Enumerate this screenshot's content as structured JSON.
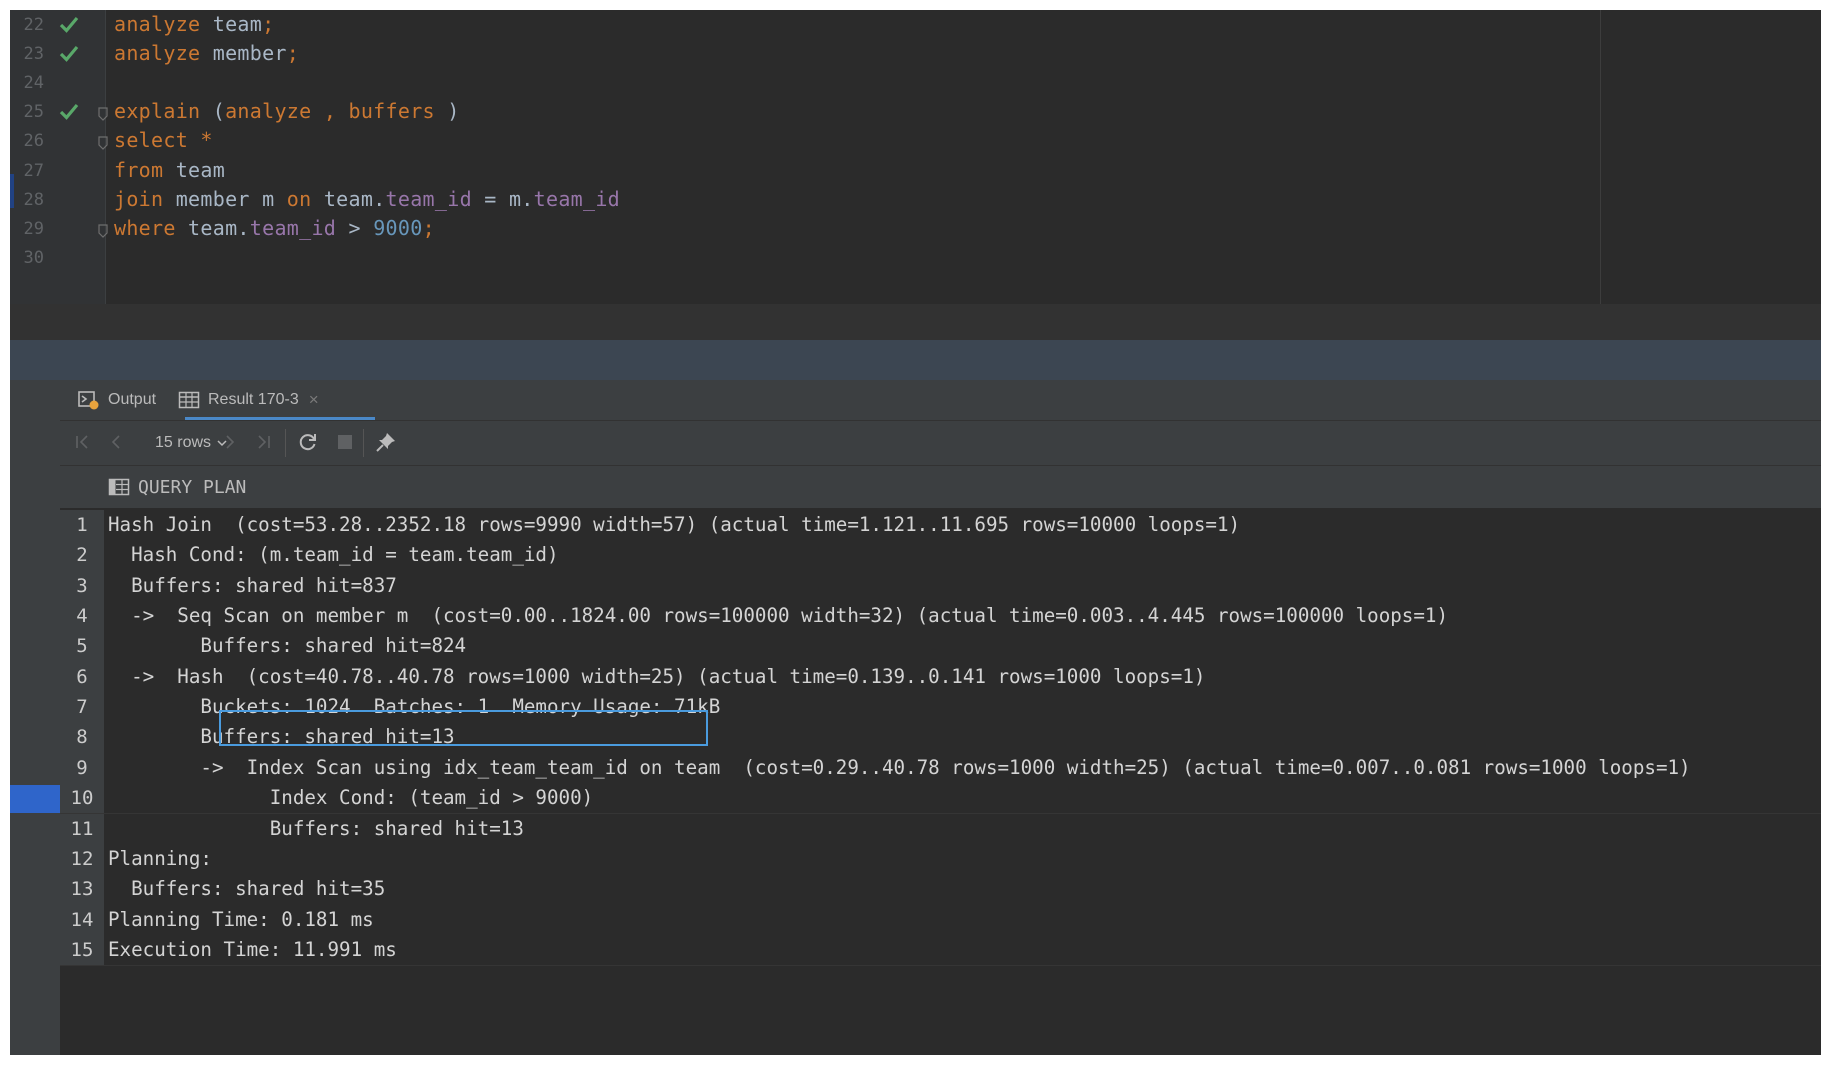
{
  "editor": {
    "lines": [
      {
        "num": "22",
        "status": "check",
        "tokens": [
          {
            "t": "analyze",
            "c": "kw"
          },
          {
            "t": " team",
            "c": ""
          },
          {
            "t": ";",
            "c": "kw"
          }
        ]
      },
      {
        "num": "23",
        "status": "check",
        "tokens": [
          {
            "t": "analyze",
            "c": "kw"
          },
          {
            "t": " member",
            "c": ""
          },
          {
            "t": ";",
            "c": "kw"
          }
        ]
      },
      {
        "num": "24",
        "status": "",
        "tokens": []
      },
      {
        "num": "25",
        "status": "check",
        "fold": true,
        "tokens": [
          {
            "t": "explain",
            "c": "kw"
          },
          {
            "t": " (",
            "c": ""
          },
          {
            "t": "analyze",
            "c": "kw"
          },
          {
            "t": " ",
            "c": ""
          },
          {
            "t": ",",
            "c": "kw"
          },
          {
            "t": " ",
            "c": ""
          },
          {
            "t": "buffers",
            "c": "kw"
          },
          {
            "t": " )",
            "c": ""
          }
        ]
      },
      {
        "num": "26",
        "status": "",
        "fold": true,
        "tokens": [
          {
            "t": "select",
            "c": "kw"
          },
          {
            "t": " *",
            "c": "kw"
          }
        ]
      },
      {
        "num": "27",
        "status": "",
        "tokens": [
          {
            "t": "from",
            "c": "kw"
          },
          {
            "t": " team",
            "c": ""
          }
        ]
      },
      {
        "num": "28",
        "status": "",
        "tokens": [
          {
            "t": "join",
            "c": "kw"
          },
          {
            "t": " member m ",
            "c": ""
          },
          {
            "t": "on",
            "c": "kw"
          },
          {
            "t": " team.",
            "c": ""
          },
          {
            "t": "team_id",
            "c": "fld"
          },
          {
            "t": " = m.",
            "c": ""
          },
          {
            "t": "team_id",
            "c": "fld"
          }
        ]
      },
      {
        "num": "29",
        "status": "",
        "fold": true,
        "tokens": [
          {
            "t": "where",
            "c": "kw"
          },
          {
            "t": " team.",
            "c": ""
          },
          {
            "t": "team_id",
            "c": "fld"
          },
          {
            "t": " > ",
            "c": ""
          },
          {
            "t": "9000",
            "c": "num"
          },
          {
            "t": ";",
            "c": "kw"
          }
        ]
      },
      {
        "num": "30",
        "status": "",
        "tokens": []
      }
    ]
  },
  "tabs": {
    "output_label": "Output",
    "result_label": "Result 170-3"
  },
  "toolbar": {
    "rows_label": "15 rows"
  },
  "grid": {
    "column": "QUERY PLAN",
    "rows": [
      {
        "n": "1",
        "text": "Hash Join  (cost=53.28..2352.18 rows=9990 width=57) (actual time=1.121..11.695 rows=10000 loops=1)"
      },
      {
        "n": "2",
        "text": "  Hash Cond: (m.team_id = team.team_id)"
      },
      {
        "n": "3",
        "text": "  Buffers: shared hit=837"
      },
      {
        "n": "4",
        "text": "  ->  Seq Scan on member m  (cost=0.00..1824.00 rows=100000 width=32) (actual time=0.003..4.445 rows=100000 loops=1)"
      },
      {
        "n": "5",
        "text": "        Buffers: shared hit=824"
      },
      {
        "n": "6",
        "text": "  ->  Hash  (cost=40.78..40.78 rows=1000 width=25) (actual time=0.139..0.141 rows=1000 loops=1)"
      },
      {
        "n": "7",
        "text": "        Buckets: 1024  Batches: 1  Memory Usage: 71kB"
      },
      {
        "n": "8",
        "text": "        Buffers: shared hit=13"
      },
      {
        "n": "9",
        "text": "        ->  Index Scan using idx_team_team_id on team  (cost=0.29..40.78 rows=1000 width=25) (actual time=0.007..0.081 rows=1000 loops=1)"
      },
      {
        "n": "10",
        "text": "              Index Cond: (team_id > 9000)"
      },
      {
        "n": "11",
        "text": "              Buffers: shared hit=13"
      },
      {
        "n": "12",
        "text": "Planning:"
      },
      {
        "n": "13",
        "text": "  Buffers: shared hit=35"
      },
      {
        "n": "14",
        "text": "Planning Time: 0.181 ms"
      },
      {
        "n": "15",
        "text": "Execution Time: 11.991 ms"
      }
    ]
  },
  "icons": {
    "check": "check-icon",
    "output": "console-run-icon",
    "result": "table-icon",
    "first": "first-page-icon",
    "prev": "previous-page-icon",
    "next": "next-page-icon",
    "last": "last-page-icon",
    "reload": "reload-icon",
    "stop": "stop-icon",
    "pin": "pin-icon"
  },
  "colors": {
    "keyword": "#cc7832",
    "field": "#9876aa",
    "number": "#6897bb",
    "check": "#59a869",
    "highlight_border": "#4a9bde",
    "selection": "#2f65ca"
  }
}
